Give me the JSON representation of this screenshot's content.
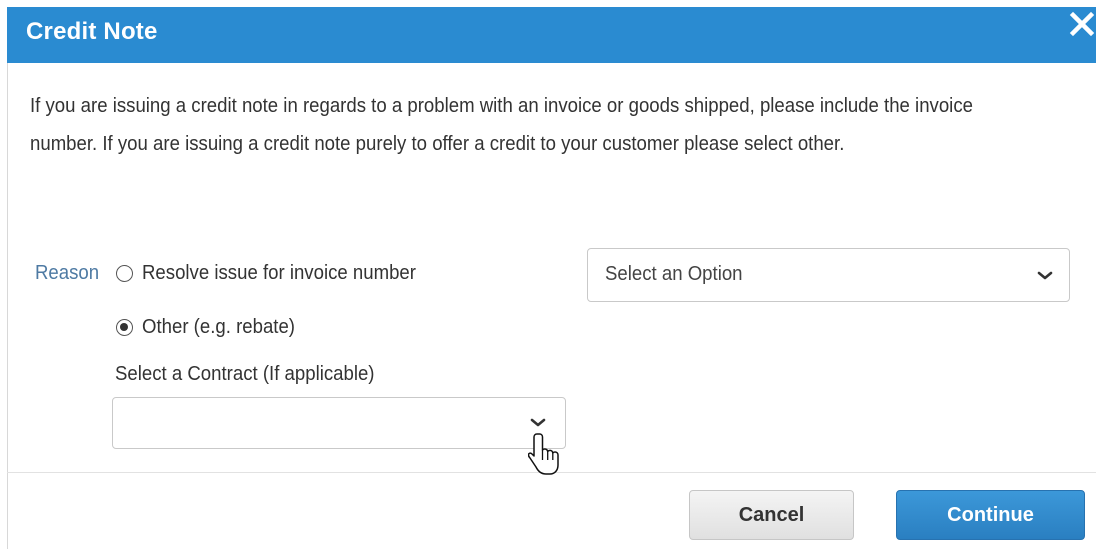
{
  "dialog": {
    "title": "Credit Note",
    "close_icon": "close-icon",
    "intro_text": "If you are issuing a credit note in regards to a problem with an invoice or goods shipped, please include the invoice number. If you are issuing a credit note purely to offer a credit to your customer please select other."
  },
  "reason": {
    "label": "Reason",
    "options": [
      {
        "label": "Resolve issue for invoice number",
        "checked": false
      },
      {
        "label": "Other (e.g. rebate)",
        "checked": true
      }
    ],
    "invoice_select": {
      "value": "Select an Option",
      "icon": "chevron-down-icon"
    }
  },
  "contract": {
    "label": "Select a Contract (If applicable)",
    "value": "",
    "icon": "chevron-down-icon"
  },
  "footer": {
    "cancel_label": "Cancel",
    "continue_label": "Continue"
  },
  "colors": {
    "title_bar": "#2a8bd1",
    "reason_label": "#4e7aa3",
    "continue_button": "#2a7fc1"
  },
  "cursor": {
    "icon": "hand-pointer-icon"
  }
}
